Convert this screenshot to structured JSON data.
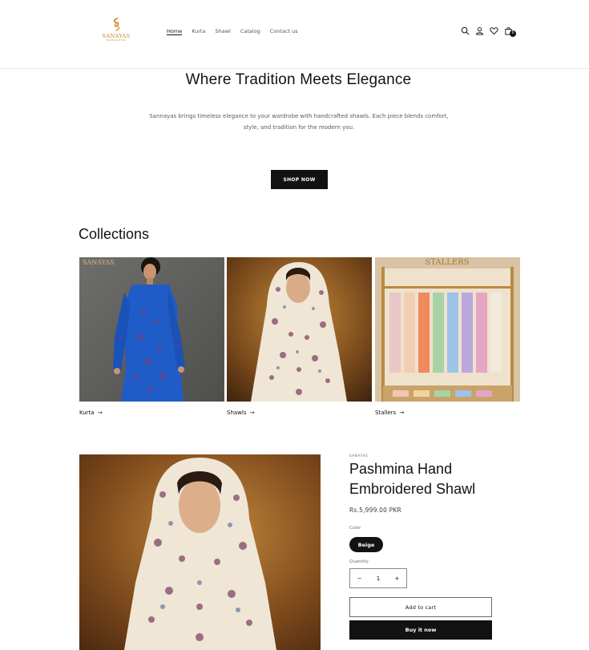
{
  "brand": {
    "logo_text": "SANAYAS",
    "logo_subtext": "HANDCRAFTED",
    "logo_color": "#c8842b"
  },
  "nav": {
    "items": [
      {
        "label": "Home",
        "active": true
      },
      {
        "label": "Kurta"
      },
      {
        "label": "Shawl"
      },
      {
        "label": "Catalog"
      },
      {
        "label": "Contact us"
      }
    ]
  },
  "header_icons": [
    "search-icon",
    "account-icon",
    "wishlist-icon",
    "cart-icon"
  ],
  "cart": {
    "count": "0"
  },
  "hero": {
    "title": "Where Tradition Meets Elegance",
    "description": "Sannayas brings timeless elegance to your wardrobe with handcrafted shawls. Each piece blends comfort, style, and tradition for the modern you.",
    "button_label": "SHOP NOW"
  },
  "collections": {
    "heading": "Collections",
    "items": [
      {
        "label": "Kurta",
        "arrow": "→",
        "image_text": "SANAYAS"
      },
      {
        "label": "Shawls",
        "arrow": "→"
      },
      {
        "label": "Stallers",
        "arrow": "→",
        "image_text": "STALLERS"
      }
    ]
  },
  "product": {
    "vendor": "SANAYAS",
    "title": "Pashmina Hand Embroidered Shawl",
    "price": "Rs.5,999.00 PKR",
    "color_label": "Color",
    "color_value": "Beige",
    "quantity_label": "Quantity",
    "quantity_minus": "−",
    "quantity_value": "1",
    "quantity_plus": "+",
    "add_to_cart_label": "Add to cart",
    "buy_now_label": "Buy it now"
  },
  "colors": {
    "primary": "#121212",
    "accent": "#c8842b",
    "kurta_blue": "#1f5cc8"
  }
}
